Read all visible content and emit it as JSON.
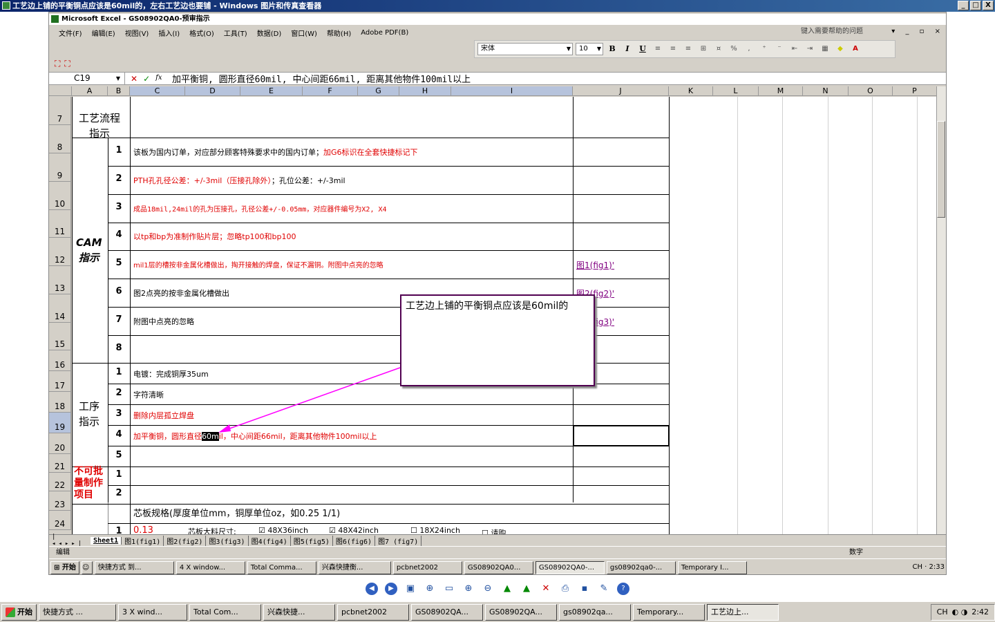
{
  "window": {
    "title": "工艺边上铺的平衡铜点应该是60mil的，左右工艺边也要铺 - Windows 图片和传真查看器",
    "min": "_",
    "max": "□",
    "close": "X"
  },
  "excel": {
    "title": "Microsoft Excel - GS08902QA0-预审指示",
    "menu": [
      "文件(F)",
      "编辑(E)",
      "视图(V)",
      "插入(I)",
      "格式(O)",
      "工具(T)",
      "数据(D)",
      "窗口(W)",
      "帮助(H)",
      "Adobe PDF(B)"
    ],
    "help_placeholder": "键入需要帮助的问题",
    "font": "宋体",
    "font_size": "10",
    "name_box": "C19",
    "formula": "加平衡铜, 圆形直径60mil, 中心间距66mil, 距离其他物件100mil以上",
    "columns": [
      "A",
      "B",
      "C",
      "D",
      "E",
      "F",
      "G",
      "H",
      "I",
      "J",
      "K",
      "L",
      "M",
      "N",
      "O",
      "P"
    ],
    "rows": [
      "7",
      "8",
      "9",
      "10",
      "11",
      "12",
      "13",
      "14",
      "15",
      "16",
      "17",
      "18",
      "19",
      "20",
      "21",
      "22",
      "23",
      "24"
    ],
    "section_labels": {
      "process_flow": "工艺流程\n指示",
      "cam": "CAM\n指示",
      "procedure": "工序\n指示",
      "not_batch": "不可批\n量制作\n项目"
    },
    "cam_items": [
      {
        "n": "1",
        "text": "该板为国内订单，对应部分顾客特殊要求中的国内订单；",
        "text_red": "加G6标识在全套快捷标记下"
      },
      {
        "n": "2",
        "text": "",
        "text_red": "PTH孔孔径公差：+/-3mil（压接孔除外）",
        "text2": "；孔位公差：+/-3mil"
      },
      {
        "n": "3",
        "text": "",
        "text_red": "成品18mil,24mil的孔为压接孔，孔径公差+/-0.05mm，对应器件编号为X2, X4"
      },
      {
        "n": "4",
        "text": "",
        "text_red": "以tp和bp为准制作贴片层；忽略tp100和bp100"
      },
      {
        "n": "5",
        "text": "",
        "text_red": "mil1层的槽按非金属化槽做出，掏开接触的焊盘，保证不漏铜。附图中点亮的忽略"
      },
      {
        "n": "6",
        "text": "图2点亮的按非金属化槽做出",
        "text_red": ""
      },
      {
        "n": "7",
        "text": "附图中点亮的忽略",
        "text_red": ""
      },
      {
        "n": "8",
        "text": "",
        "text_red": ""
      }
    ],
    "links": [
      "图1(fig1)'",
      "图2(fig2)'",
      "图3(fig3)'"
    ],
    "proc_items": [
      {
        "n": "1",
        "text": "电镀：完成铜厚35um",
        "red": false
      },
      {
        "n": "2",
        "text": "字符清晰",
        "red": false
      },
      {
        "n": "3",
        "text": "删除内层孤立焊盘",
        "red": true
      },
      {
        "n": "4",
        "text_a": "加平衡铜，圆形直径",
        "text_hl": "60m",
        "text_b": "il，中心间距66mil，距离其他物件100mil以上",
        "red": true
      },
      {
        "n": "5",
        "text": "",
        "red": false
      }
    ],
    "not_batch_items": [
      "1",
      "2"
    ],
    "core_spec_label": "芯板规格(厚度单位mm，铜厚单位oz，如0.25 1/1)",
    "row24": {
      "n": "1",
      "value": "0.13",
      "label": "芯板大料尺寸:",
      "opt1": "48X36inch",
      "opt2": "48X42inch",
      "opt3": "18X24inch",
      "opt4": "请购"
    },
    "comment": "工艺边上铺的平衡铜点应该是60mil的",
    "sheets": [
      "Sheet1",
      "图1(fig1)",
      "图2(fig2)",
      "图3(fig3)",
      "图4(fig4)",
      "图5(fig5)",
      "图6(fig6)",
      "图7 (fig7)"
    ],
    "status_left": "编辑",
    "status_right": "数字"
  },
  "inner_taskbar": {
    "start": "开始",
    "items": [
      "快捷方式 到...",
      "4 X window...",
      "Total Comma...",
      "兴森快捷衡...",
      "pcbnet2002",
      "GS08902QA0...",
      "GS08902QA0-...",
      "gs08902qa0-...",
      "Temporary I..."
    ],
    "lang": "CH",
    "time": "2:33"
  },
  "taskbar": {
    "start": "开始",
    "items": [
      "快捷方式 ...",
      "3 X wind...",
      "Total Com...",
      "兴森快捷...",
      "pcbnet2002",
      "GS08902QA...",
      "GS08902QA...",
      "gs08902qa...",
      "Temporary...",
      "工艺边上..."
    ],
    "lang": "CH",
    "time": "2:42"
  }
}
